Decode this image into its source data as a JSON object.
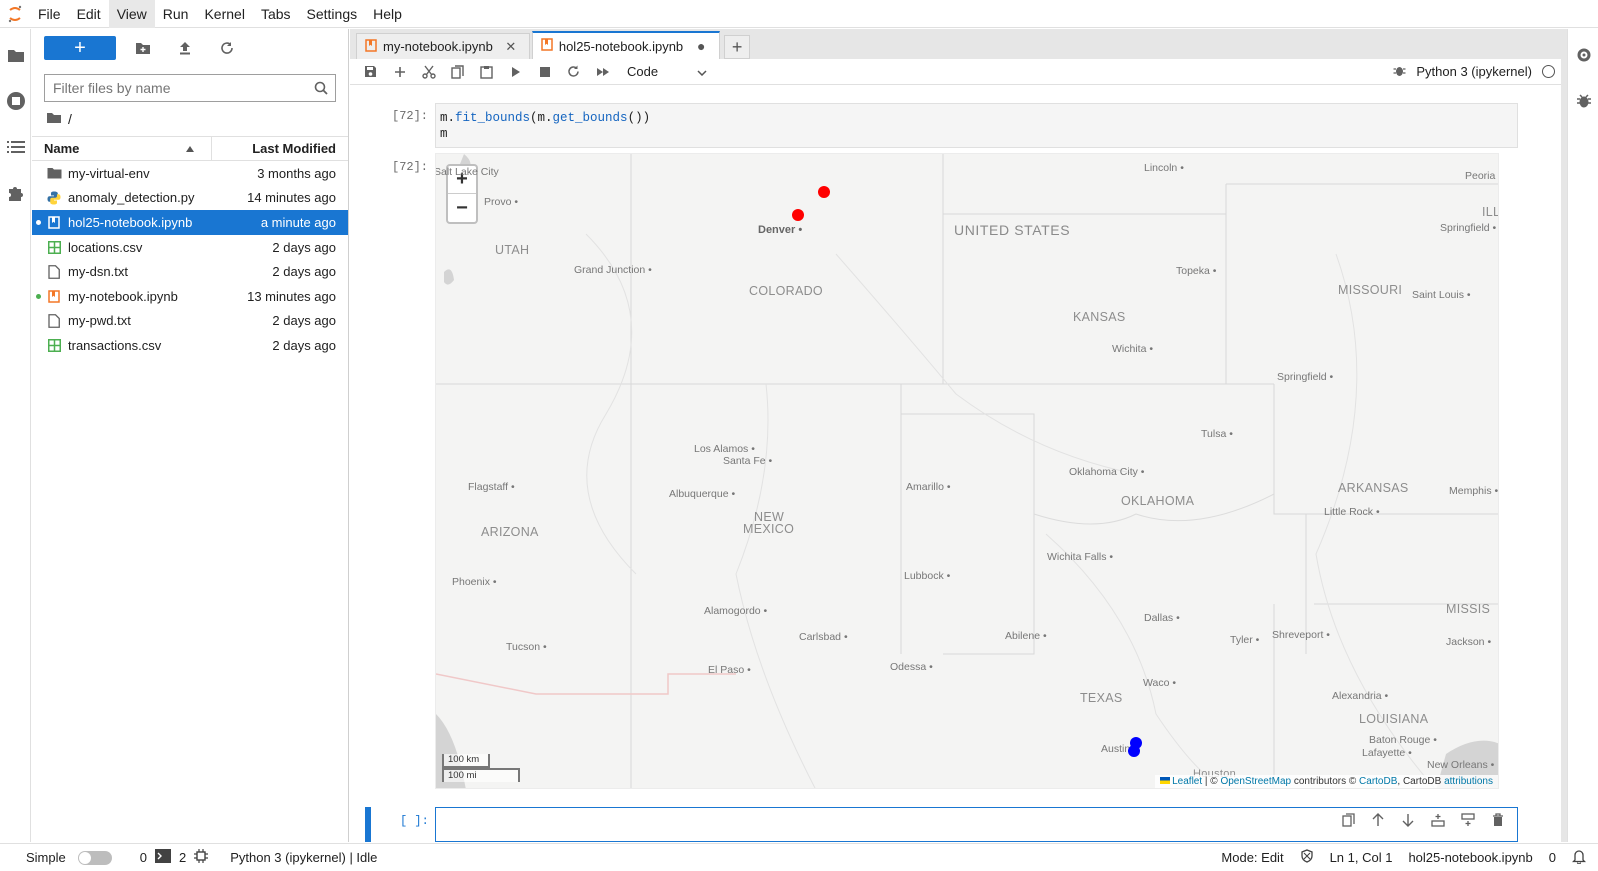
{
  "menubar": {
    "items": [
      "File",
      "Edit",
      "View",
      "Run",
      "Kernel",
      "Tabs",
      "Settings",
      "Help"
    ],
    "active": "View"
  },
  "filebrowser": {
    "new_label": "+",
    "filter_placeholder": "Filter files by name",
    "breadcrumb": "/",
    "col_name": "Name",
    "col_modified": "Last Modified",
    "files": [
      {
        "name": "my-virtual-env",
        "modified": "3 months ago",
        "icon": "folder-icon"
      },
      {
        "name": "anomaly_detection.py",
        "modified": "14 minutes ago",
        "icon": "python-file-icon"
      },
      {
        "name": "hol25-notebook.ipynb",
        "modified": "a minute ago",
        "icon": "notebook-icon",
        "selected": true,
        "running": true
      },
      {
        "name": "locations.csv",
        "modified": "2 days ago",
        "icon": "spreadsheet-icon"
      },
      {
        "name": "my-dsn.txt",
        "modified": "2 days ago",
        "icon": "text-file-icon"
      },
      {
        "name": "my-notebook.ipynb",
        "modified": "13 minutes ago",
        "icon": "notebook-icon",
        "running": true
      },
      {
        "name": "my-pwd.txt",
        "modified": "2 days ago",
        "icon": "text-file-icon"
      },
      {
        "name": "transactions.csv",
        "modified": "2 days ago",
        "icon": "spreadsheet-icon"
      }
    ]
  },
  "tabs": [
    {
      "label": "my-notebook.ipynb",
      "active": false
    },
    {
      "label": "hol25-notebook.ipynb",
      "active": true
    }
  ],
  "notebook": {
    "cell_type": "Code",
    "kernel": "Python 3 (ipykernel)",
    "cell1_prompt": "[72]:",
    "cell1_line1_pre": "m.",
    "cell1_line1_fn1": "fit_bounds",
    "cell1_line1_mid": "(m.",
    "cell1_line1_fn2": "get_bounds",
    "cell1_line1_post": "())",
    "cell1_line2": "m",
    "out_prompt": "[72]:",
    "cell2_prompt": "[ ]:"
  },
  "map": {
    "zoom_in": "+",
    "zoom_out": "−",
    "labels": {
      "country": "UNITED STATES",
      "states": [
        "UTAH",
        "COLORADO",
        "KANSAS",
        "MISSOURI",
        "ARIZONA",
        "NEW",
        "MEXICO",
        "OKLAHOMA",
        "ARKANSAS",
        "TEXAS",
        "LOUISIANA",
        "ILLI",
        "MISSIS"
      ],
      "cities": [
        "Lincoln",
        "Peoria",
        "Springfield",
        "Provo",
        "Denver",
        "Grand Junction",
        "Topeka",
        "Saint Louis",
        "Wichita",
        "Springfield",
        "Los Alamos",
        "Santa Fe",
        "Tulsa",
        "Flagstaff",
        "Albuquerque",
        "Amarillo",
        "Oklahoma City",
        "Memphis",
        "Little Rock",
        "Wichita Falls",
        "Phoenix",
        "Lubbock",
        "Alamogordo",
        "Dallas",
        "Tyler",
        "Shreveport",
        "Jackson",
        "Tucson",
        "Carlsbad",
        "Abilene",
        "El Paso",
        "Odessa",
        "Waco",
        "Alexandria",
        "Baton Rouge",
        "Lafayette",
        "Austin",
        "New Orleans",
        "Houston",
        "Salt Lake City"
      ]
    },
    "markers_red": 2,
    "markers_blue": 2,
    "scale_km": "100 km",
    "scale_mi": "100 mi",
    "attribution": {
      "leaflet": "Leaflet",
      "sep1": " | © ",
      "osm": "OpenStreetMap",
      "contrib": " contributors © ",
      "carto": "CartoDB",
      "mid": ", CartoDB ",
      "attr": "attributions"
    },
    "colors": {
      "red_marker": "#ff0000",
      "blue_marker": "#0000ff"
    }
  },
  "statusbar": {
    "mode_label": "Simple",
    "terminals": "0",
    "kernels": "2",
    "kernel_status": "Python 3 (ipykernel) | Idle",
    "mode": "Mode: Edit",
    "position": "Ln 1, Col 1",
    "filename": "hol25-notebook.ipynb",
    "notifications": "0"
  }
}
